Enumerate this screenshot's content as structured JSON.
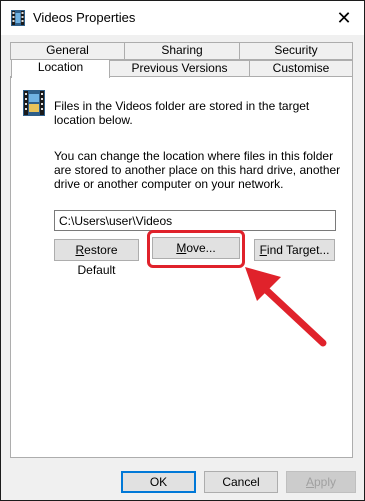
{
  "window": {
    "title": "Videos Properties",
    "close_glyph": "✕"
  },
  "tabs": {
    "row1": [
      "General",
      "Sharing",
      "Security"
    ],
    "row2": [
      "Location",
      "Previous Versions",
      "Customise"
    ],
    "selected": "Location"
  },
  "location": {
    "info": "Files in the Videos folder are stored in the target location below.",
    "description": "You can change the location where files in this folder are stored to another place on this hard drive, another drive or another computer on your network.",
    "path": "C:\\Users\\user\\Videos",
    "restore_default": {
      "accel": "R",
      "rest": "estore Default"
    },
    "move": {
      "accel": "M",
      "rest": "ove..."
    },
    "find_target": {
      "accel": "F",
      "rest": "ind Target..."
    }
  },
  "footer": {
    "ok": "OK",
    "cancel": "Cancel",
    "apply": {
      "accel": "A",
      "rest": "pply"
    }
  },
  "colors": {
    "highlight": "#e0222b",
    "accent": "#0078d7"
  },
  "icons": [
    "film-folder-icon",
    "close-icon",
    "red-arrow-annotation"
  ]
}
